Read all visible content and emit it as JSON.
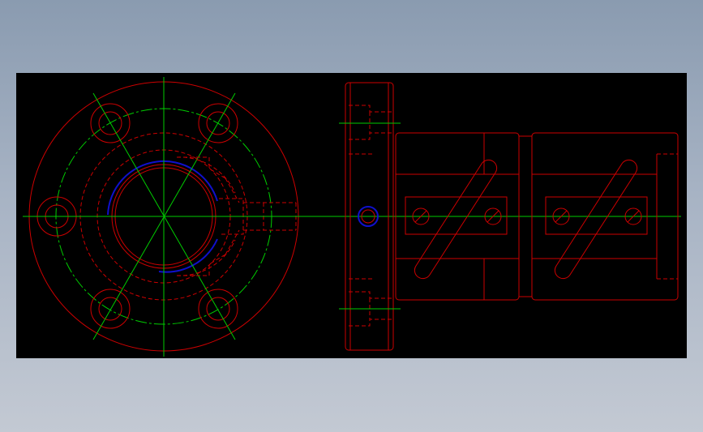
{
  "colors": {
    "background": "#000000",
    "outline": "#cc0000",
    "hidden": "#cc0000",
    "centerline": "#00cc00",
    "highlight": "#1010cc"
  },
  "drawing": {
    "views": [
      "front-view-flange",
      "side-view-coupling"
    ]
  }
}
